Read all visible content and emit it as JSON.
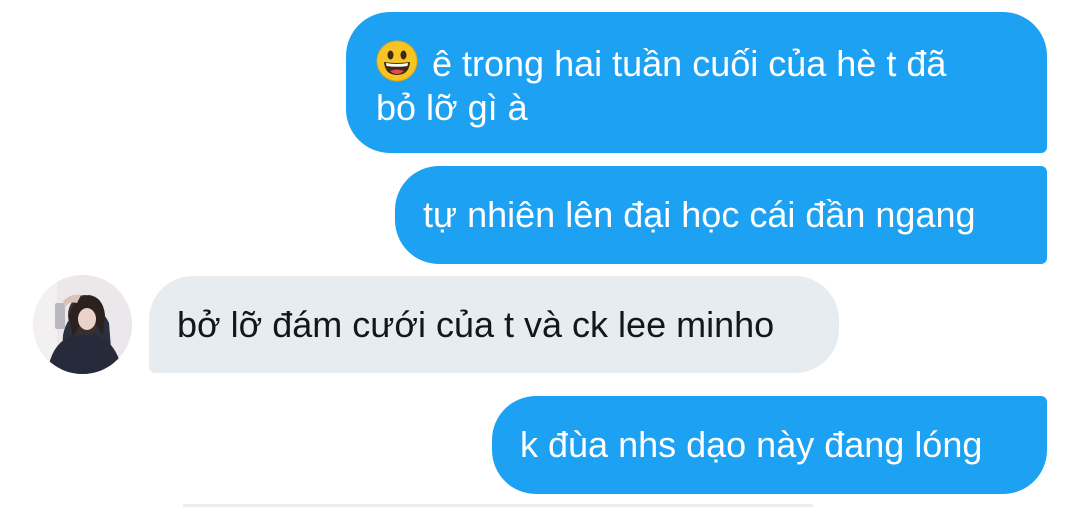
{
  "messages": [
    {
      "direction": "outgoing",
      "emoji": "grinning-face-emoji",
      "text": "ê trong hai tuần cuối của hè t đã\nbỏ lỡ gì à"
    },
    {
      "direction": "outgoing",
      "text": "tự nhiên lên đại học cái đần ngang"
    },
    {
      "direction": "incoming",
      "text": "bở lỡ đám cưới của t và ck lee minho"
    },
    {
      "direction": "outgoing",
      "text": "k đùa nhs dạo này đang lóng"
    }
  ],
  "colors": {
    "outgoing_bubble": "#1da1f2",
    "incoming_bubble": "#e6ecf0",
    "outgoing_text": "#ffffff",
    "incoming_text": "#14171a"
  }
}
